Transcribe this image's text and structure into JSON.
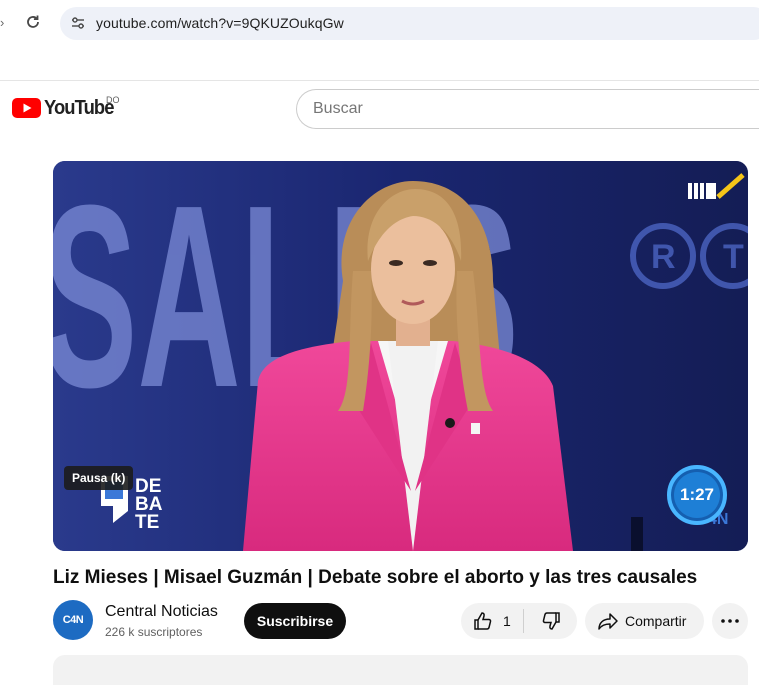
{
  "browser": {
    "url": "youtube.com/watch?v=9QKUZOukqGw"
  },
  "header": {
    "logo_text": "YouTube",
    "country_code": "DO",
    "search_placeholder": "Buscar"
  },
  "player": {
    "tooltip": "Pausa (k)",
    "overlay_time": "1:27"
  },
  "video": {
    "title": "Liz Mieses | Misael Guzmán | Debate sobre el aborto y las tres causales"
  },
  "channel": {
    "name": "Central Noticias",
    "subscribers": "226 k suscriptores",
    "avatar_text": "C4N"
  },
  "actions": {
    "subscribe_label": "Suscribirse",
    "like_count": "1",
    "share_label": "Compartir"
  },
  "colors": {
    "brand_red": "#ff0000",
    "subscribe_bg": "#0f0f0f",
    "chip_bg": "#f2f2f2"
  }
}
